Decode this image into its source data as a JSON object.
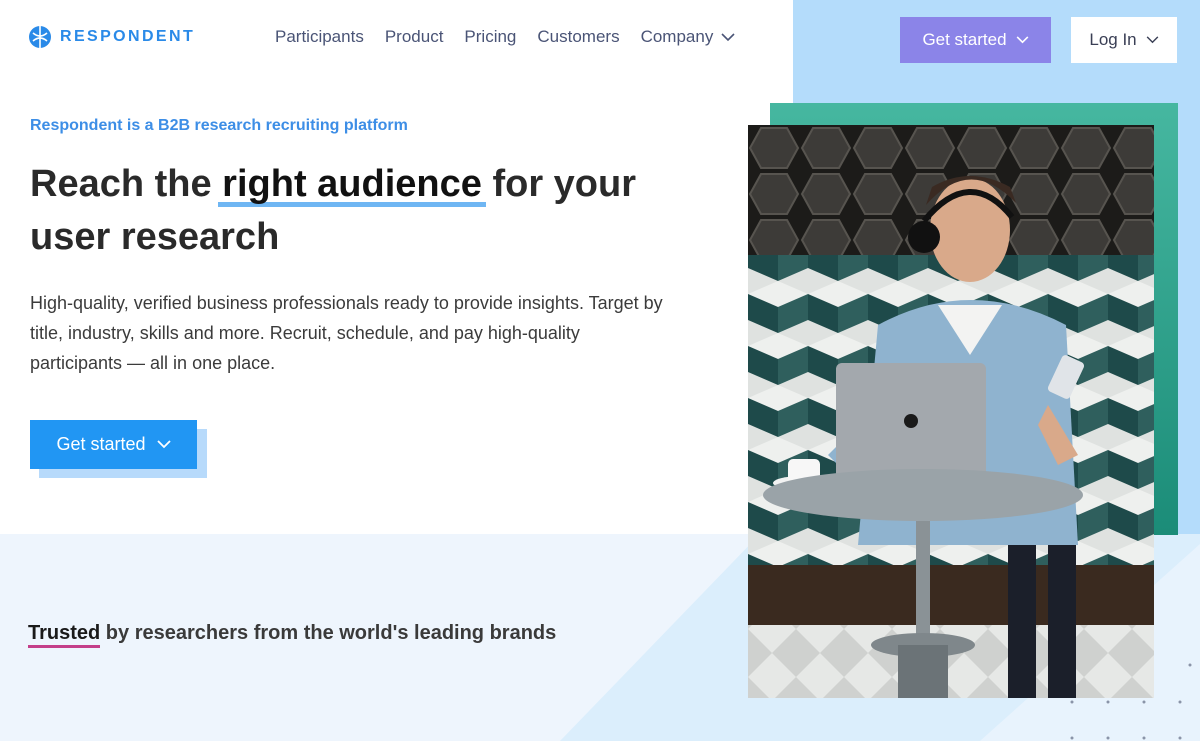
{
  "brand": {
    "name": "RESPONDENT"
  },
  "nav": {
    "items": [
      {
        "label": "Participants"
      },
      {
        "label": "Product"
      },
      {
        "label": "Pricing"
      },
      {
        "label": "Customers"
      },
      {
        "label": "Company"
      }
    ]
  },
  "header": {
    "get_started": "Get started",
    "log_in": "Log In"
  },
  "hero": {
    "eyebrow": "Respondent is a B2B research recruiting platform",
    "headline_before": "Reach the ",
    "headline_highlight": "right audience",
    "headline_after": " for your user research",
    "subcopy": "High-quality, verified business professionals ready to provide insights. Target by title, industry, skills and more. Recruit, schedule, and pay high-quality participants — all in one place.",
    "cta": "Get started"
  },
  "trusted": {
    "word": "Trusted",
    "rest": " by researchers from the world's leading brands"
  },
  "colors": {
    "brand_blue": "#2196f3",
    "header_cta": "#8b84e8",
    "accent_teal": "#1b8c78",
    "underline_pink": "#c43f8a"
  },
  "icons": [
    "respondent-logo-icon",
    "chevron-down-icon",
    "photo-man-laptop"
  ]
}
